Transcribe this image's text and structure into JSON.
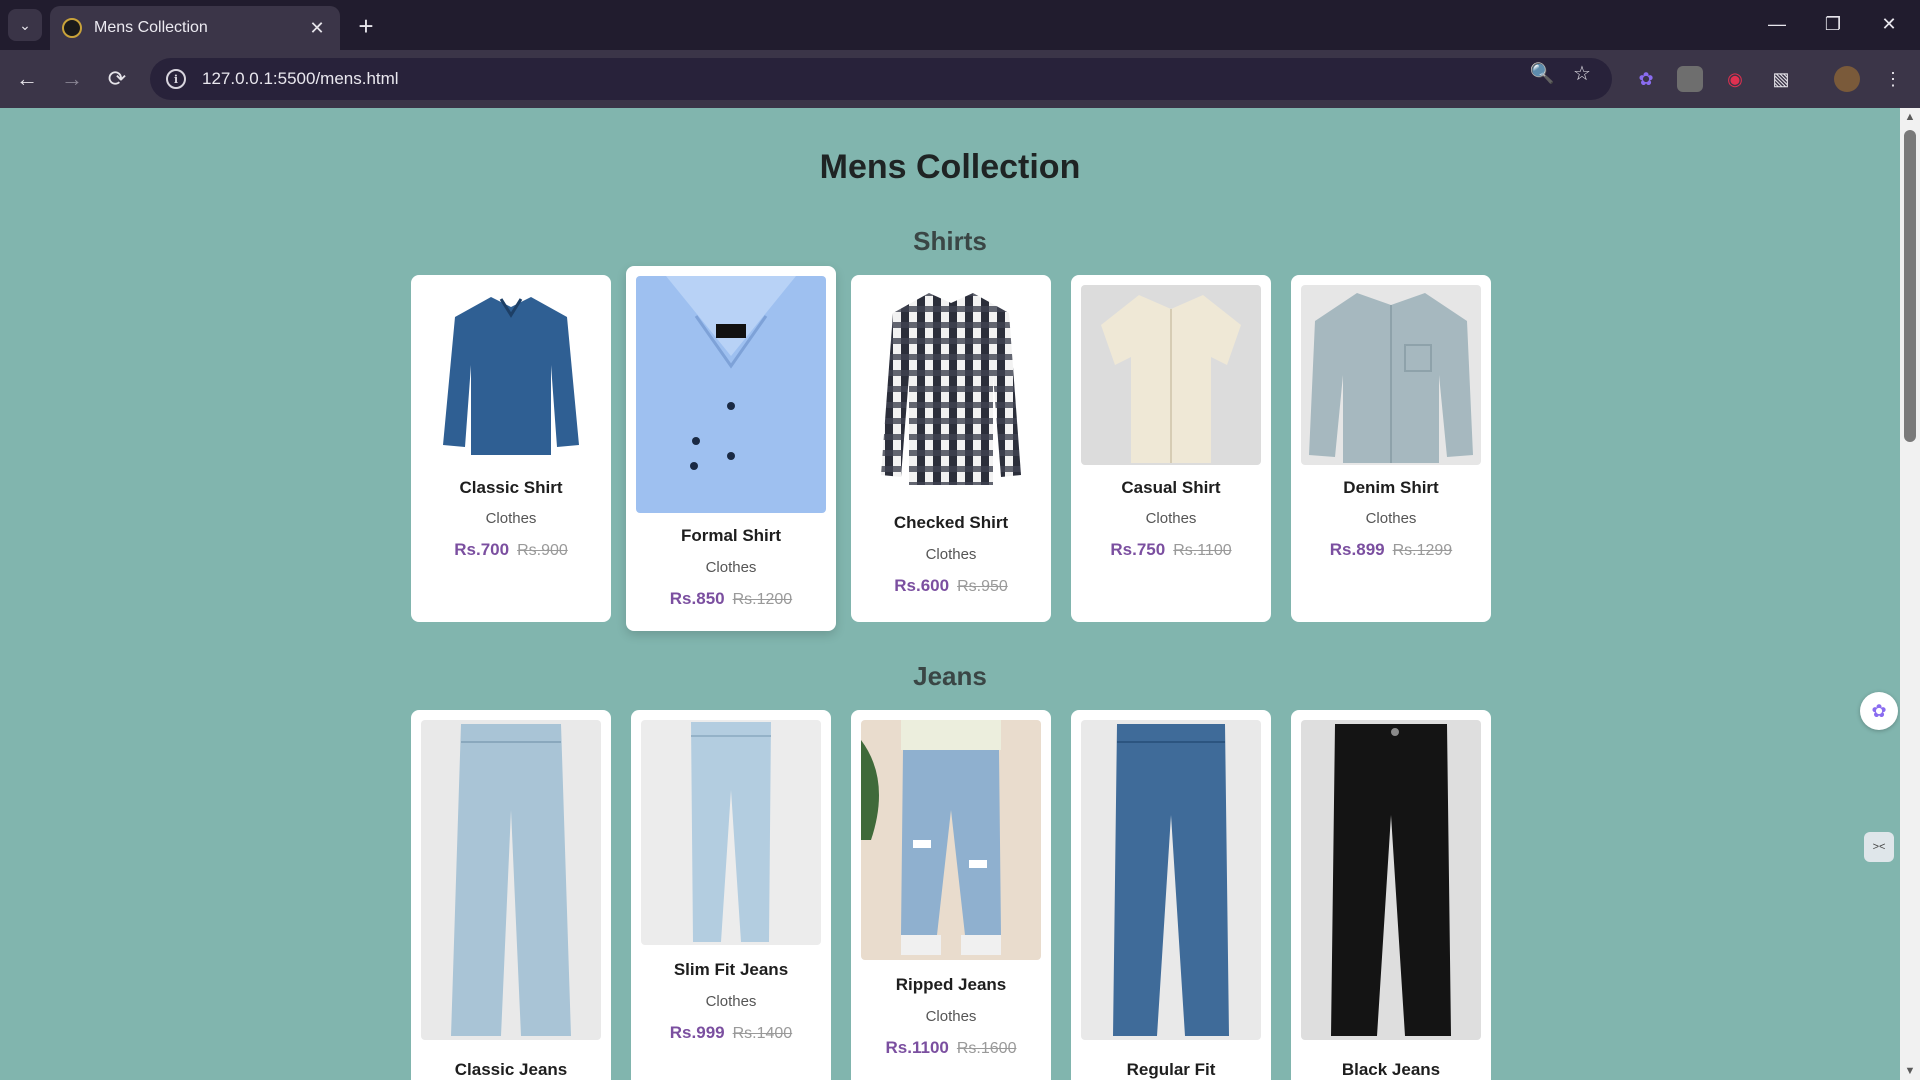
{
  "browser": {
    "tab_title": "Mens Collection",
    "url": "127.0.0.1:5500/mens.html"
  },
  "page": {
    "title": "Mens Collection",
    "sections": [
      {
        "title": "Shirts",
        "products": [
          {
            "name": "Classic Shirt",
            "category": "Clothes",
            "price": "Rs.700",
            "old_price": "Rs.900",
            "image_color": "#2f5f93"
          },
          {
            "name": "Formal Shirt",
            "category": "Clothes",
            "price": "Rs.850",
            "old_price": "Rs.1200",
            "image_color": "#9ec0f0"
          },
          {
            "name": "Checked Shirt",
            "category": "Clothes",
            "price": "Rs.600",
            "old_price": "Rs.950",
            "image_color": "#4a4d58"
          },
          {
            "name": "Casual Shirt",
            "category": "Clothes",
            "price": "Rs.750",
            "old_price": "Rs.1100",
            "image_color": "#efe8d6"
          },
          {
            "name": "Denim Shirt",
            "category": "Clothes",
            "price": "Rs.899",
            "old_price": "Rs.1299",
            "image_color": "#a6b8bf"
          }
        ]
      },
      {
        "title": "Jeans",
        "products": [
          {
            "name": "Classic Jeans",
            "image_color": "#a9c4d6"
          },
          {
            "name": "Slim Fit Jeans",
            "category": "Clothes",
            "price": "Rs.999",
            "old_price": "Rs.1400",
            "image_color": "#b3cde0"
          },
          {
            "name": "Ripped Jeans",
            "category": "Clothes",
            "price": "Rs.1100",
            "old_price": "Rs.1600",
            "image_color": "#8fb0cf"
          },
          {
            "name": "Regular Fit",
            "image_color": "#3f6b99"
          },
          {
            "name": "Black Jeans",
            "image_color": "#141414"
          }
        ]
      }
    ]
  }
}
